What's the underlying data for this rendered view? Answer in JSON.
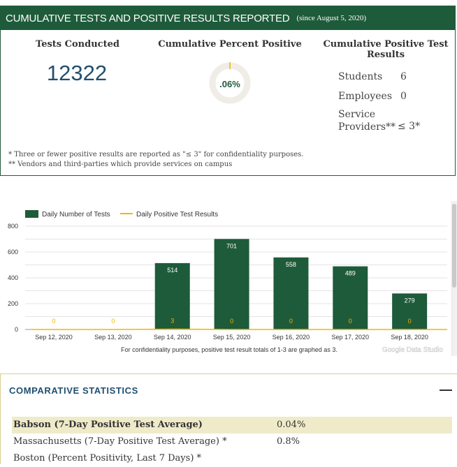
{
  "banner": {
    "title": "CUMULATIVE TESTS AND POSITIVE RESULTS REPORTED",
    "subtitle": "(since August 5, 2020)"
  },
  "tests": {
    "title": "Tests Conducted",
    "value": "12322"
  },
  "percent": {
    "title": "Cumulative Percent Positive",
    "value": ".06%",
    "fraction": 0.0006
  },
  "positives": {
    "title_line1": "Cumulative Positive Test",
    "title_line2": "Results",
    "rows": [
      {
        "label": "Students",
        "value": "6"
      },
      {
        "label": "Employees",
        "value": "0"
      },
      {
        "label_line1": "Service",
        "label_line2": "Providers**",
        "value": "≤ 3*"
      }
    ]
  },
  "footnotes": {
    "note1": "* Three or fewer positive results are reported as \"≤ 3\" for confidentiality purposes.",
    "note2": "** Vendors and third-parties which provide services on campus"
  },
  "colors": {
    "green": "#1e5b3a",
    "gold": "#f5b400",
    "highlight": "#efebc9",
    "blue": "#1f4f6e"
  },
  "chart_data": {
    "type": "bar",
    "categories": [
      "Sep 12, 2020",
      "Sep 13, 2020",
      "Sep 14, 2020",
      "Sep 15, 2020",
      "Sep 16, 2020",
      "Sep 17, 2020",
      "Sep 18, 2020"
    ],
    "series": [
      {
        "name": "Daily Number of Tests",
        "values": [
          0,
          0,
          514,
          701,
          558,
          489,
          279
        ],
        "labels": [
          "",
          "",
          "514",
          "701",
          "558",
          "489",
          "279"
        ]
      },
      {
        "name": "Daily Positive Test Results",
        "values": [
          0,
          0,
          3,
          0,
          0,
          0,
          0
        ],
        "labels": [
          "0",
          "0",
          "3",
          "0",
          "0",
          "0",
          "0"
        ]
      }
    ],
    "yticks": [
      "0",
      "200",
      "400",
      "600",
      "800"
    ],
    "ylim": [
      0,
      800
    ],
    "caption": "For confidentiality purposes, positive test result totals of 1-3 are graphed as 3.",
    "watermark": "Google Data Studio",
    "legend": "top-left",
    "grid": true
  },
  "comparative": {
    "title": "COMPARATIVE STATISTICS",
    "rows": [
      {
        "label": "Babson (7-Day Positive Test Average)",
        "value": "0.04%"
      },
      {
        "label": "Massachusetts (7-Day Positive Test Average) *",
        "value": "0.8%"
      },
      {
        "label": "Boston (Percent Positivity, Last 7 Days) *",
        "value": ""
      }
    ]
  }
}
